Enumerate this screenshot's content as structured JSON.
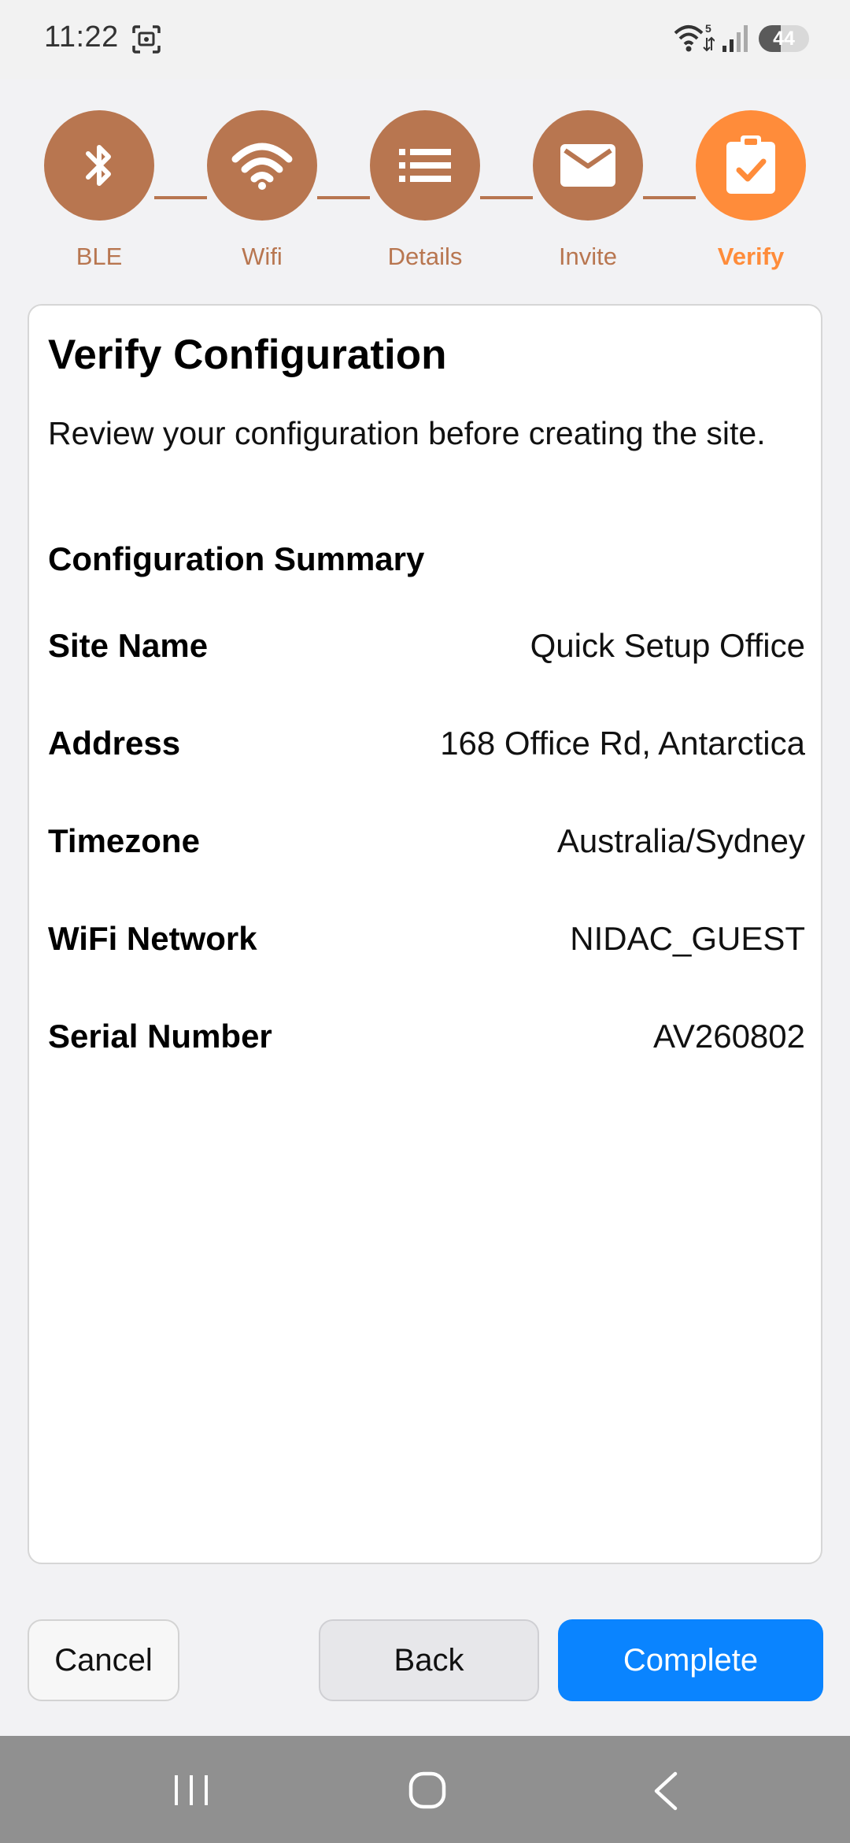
{
  "status_bar": {
    "time": "11:22",
    "wifi_badge": "5",
    "battery_level": "44",
    "battery_fraction": 0.44
  },
  "stepper": {
    "steps": [
      {
        "label": "BLE",
        "icon": "bluetooth-icon",
        "active": false
      },
      {
        "label": "Wifi",
        "icon": "wifi-icon",
        "active": false
      },
      {
        "label": "Details",
        "icon": "list-icon",
        "active": false
      },
      {
        "label": "Invite",
        "icon": "envelope-icon",
        "active": false
      },
      {
        "label": "Verify",
        "icon": "clipboard-check-icon",
        "active": true
      }
    ]
  },
  "card": {
    "title": "Verify Configuration",
    "description": "Review your configuration before creating the site.",
    "summary_heading": "Configuration Summary",
    "rows": [
      {
        "label": "Site Name",
        "value": "Quick Setup Office"
      },
      {
        "label": "Address",
        "value": "168 Office Rd, Antarctica"
      },
      {
        "label": "Timezone",
        "value": "Australia/Sydney"
      },
      {
        "label": "WiFi Network",
        "value": "NIDAC_GUEST"
      },
      {
        "label": "Serial Number",
        "value": "AV260802"
      }
    ]
  },
  "actions": {
    "cancel_label": "Cancel",
    "back_label": "Back",
    "complete_label": "Complete"
  },
  "colors": {
    "step_done": "#b87650",
    "step_active": "#ff8c3a",
    "primary_button": "#0a84ff"
  }
}
